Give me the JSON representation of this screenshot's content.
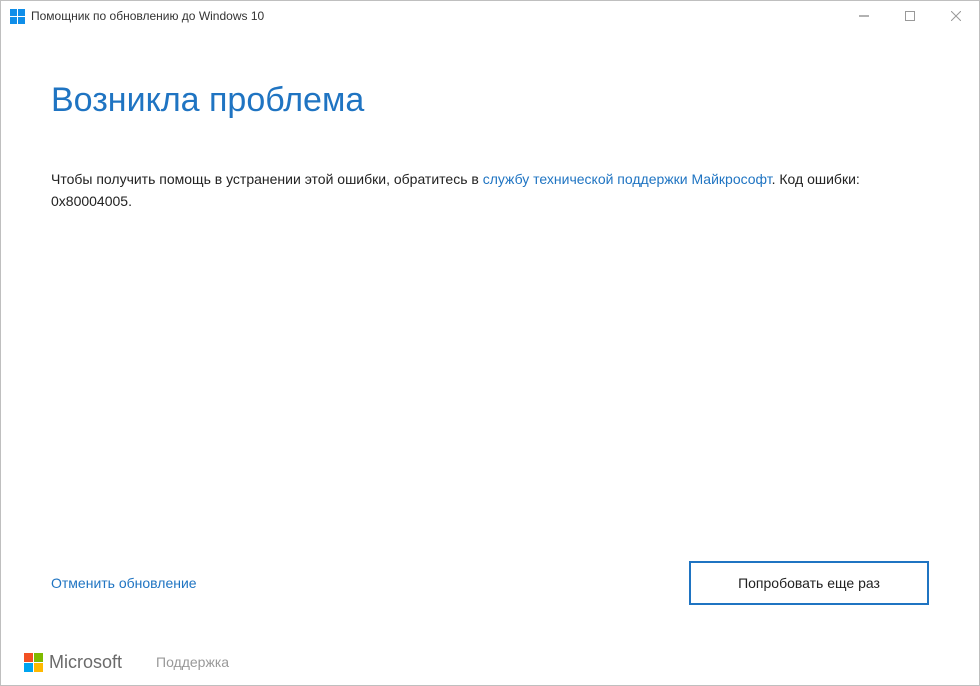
{
  "titlebar": {
    "title": "Помощник по обновлению до Windows 10"
  },
  "main": {
    "heading": "Возникла проблема",
    "body_prefix": "Чтобы получить помощь в устранении этой ошибки, обратитесь в ",
    "support_link": "службу технической поддержки Майкрософт",
    "body_suffix": ". Код ошибки: 0x80004005."
  },
  "actions": {
    "cancel": "Отменить обновление",
    "retry": "Попробовать еще раз"
  },
  "footer": {
    "brand": "Microsoft",
    "support": "Поддержка"
  }
}
